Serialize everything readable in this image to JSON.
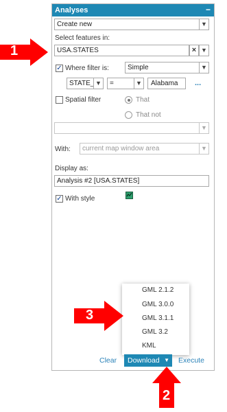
{
  "panel": {
    "title": "Analyses",
    "collapse_icon": "minus-icon",
    "mode_select": "Create new",
    "select_features_label": "Select features in:",
    "features_value": "USA.STATES",
    "where_filter": {
      "checked": true,
      "label": "Where filter is:",
      "type_select": "Simple",
      "field_select": "STATE_",
      "operator_select": "=",
      "value_input": "Alabama",
      "more_link": "..."
    },
    "spatial_filter": {
      "checked": false,
      "label": "Spatial filter",
      "option_that": "That",
      "option_that_not": "That not",
      "selected": "That"
    },
    "spatial_relation_select": "",
    "with_label": "With:",
    "with_select": "current map window area",
    "display_as_label": "Display as:",
    "display_as_value": "Analysis #2 [USA.STATES]",
    "with_style": {
      "checked": true,
      "label": "With style"
    },
    "style_icon": "style-swatch-icon"
  },
  "download_menu": {
    "items": [
      "GML 2.1.2",
      "GML 3.0.0",
      "GML 3.1.1",
      "GML 3.2",
      "KML"
    ]
  },
  "footer": {
    "clear": "Clear",
    "download": "Download",
    "execute": "Execute"
  },
  "annotations": {
    "marker_1": "1",
    "marker_2": "2",
    "marker_3": "3",
    "arrow_color": "#ff0000"
  }
}
